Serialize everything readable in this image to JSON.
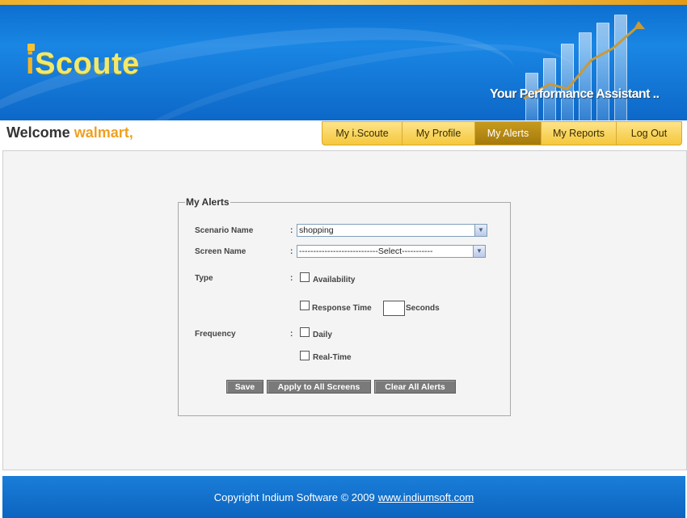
{
  "header": {
    "logo_i": "i",
    "logo_rest": "Scoute",
    "tagline": "Your Performance Assistant .."
  },
  "welcome": {
    "prefix": "Welcome",
    "user": "walmart,"
  },
  "nav": [
    {
      "label": "My i.Scoute",
      "active": false
    },
    {
      "label": "My Profile",
      "active": false
    },
    {
      "label": "My Alerts",
      "active": true
    },
    {
      "label": "My Reports",
      "active": false
    },
    {
      "label": "Log Out",
      "active": false
    }
  ],
  "form": {
    "legend": "My Alerts",
    "colon": ":",
    "scenario": {
      "label": "Scenario Name",
      "value": "shopping"
    },
    "screen": {
      "label": "Screen Name",
      "value": "----------------------------Select-----------"
    },
    "type": {
      "label": "Type",
      "availability": {
        "label": "Availability",
        "checked": false
      },
      "response_time": {
        "label": "Response Time",
        "checked": false,
        "seconds_value": "",
        "seconds_label": "Seconds"
      }
    },
    "frequency": {
      "label": "Frequency",
      "daily": {
        "label": "Daily",
        "checked": false
      },
      "realtime": {
        "label": "Real-Time",
        "checked": false
      }
    },
    "buttons": {
      "save": "Save",
      "apply_all": "Apply to All Screens",
      "clear_all": "Clear All Alerts"
    }
  },
  "footer": {
    "copyright": "Copyright Indium Software © 2009",
    "link": "www.indiumsoft.com"
  },
  "colors": {
    "banner_blue": "#0d68c8",
    "accent_orange": "#f0a020",
    "nav_yellow": "#f5c83c",
    "nav_active": "#b38512",
    "button_gray": "#7a7a7a"
  }
}
